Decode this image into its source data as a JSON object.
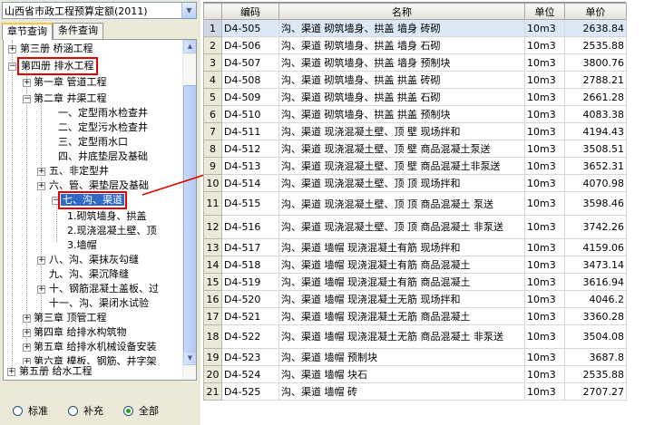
{
  "window": {
    "dropdown_value": "山西省市政工程预算定额(2011)"
  },
  "tabs": [
    {
      "label": "章节查询",
      "active": true
    },
    {
      "label": "条件查询",
      "active": false
    }
  ],
  "tree": {
    "n1": "第三册 桥涵工程",
    "n2": "第四册 排水工程",
    "n3": "第一章 管道工程",
    "n4": "第二章 井渠工程",
    "n5": "一、定型雨水检查井",
    "n6": "二、定型污水检查井",
    "n7": "三、定型雨水口",
    "n8": "四、井底垫层及基础",
    "n9": "五、非定型井",
    "n10": "六、管、渠垫层及基础",
    "n11": "七、沟、渠道",
    "n12": "1.砌筑墙身、拱盖",
    "n13": "2.现浇混凝土壁、顶",
    "n14": "3.墙帽",
    "n15": "八、沟、渠抹灰勾缝",
    "n16": "九、沟、渠沉降缝",
    "n17": "十、钢筋混凝土盖板、过",
    "n18": "十一、沟、渠闭水试验",
    "n19": "第三章 顶管工程",
    "n20": "第四章 给排水构筑物",
    "n21": "第五章 给排水机械设备安装",
    "n22": "第六章 模板、钢筋、井字架",
    "n23": "第五册 给水工程"
  },
  "filter": {
    "opt1": "标准",
    "opt2": "补充",
    "opt3": "全部",
    "selected": "全部"
  },
  "table": {
    "columns": [
      "编码",
      "名称",
      "单位",
      "单价"
    ],
    "rows": [
      {
        "n": "1",
        "code": "D4-505",
        "name": "沟、渠道 砌筑墙身、拱盖 墙身 砖砌",
        "unit": "10m3",
        "price": "2638.84"
      },
      {
        "n": "2",
        "code": "D4-506",
        "name": "沟、渠道 砌筑墙身、拱盖 墙身 石砌",
        "unit": "10m3",
        "price": "2535.88"
      },
      {
        "n": "3",
        "code": "D4-507",
        "name": "沟、渠道 砌筑墙身、拱盖 墙身 预制块",
        "unit": "10m3",
        "price": "3800.76"
      },
      {
        "n": "4",
        "code": "D4-508",
        "name": "沟、渠道 砌筑墙身、拱盖 拱盖 砖砌",
        "unit": "10m3",
        "price": "2788.21"
      },
      {
        "n": "5",
        "code": "D4-509",
        "name": "沟、渠道 砌筑墙身、拱盖 拱盖 石砌",
        "unit": "10m3",
        "price": "2661.28"
      },
      {
        "n": "6",
        "code": "D4-510",
        "name": "沟、渠道 砌筑墙身、拱盖 拱盖 预制块",
        "unit": "10m3",
        "price": "4083.38"
      },
      {
        "n": "7",
        "code": "D4-511",
        "name": "沟、渠道 现浇混凝土壁、顶 壁 现场拌和",
        "unit": "10m3",
        "price": "4194.43"
      },
      {
        "n": "8",
        "code": "D4-512",
        "name": "沟、渠道 现浇混凝土壁、顶 壁 商品混凝土泵送",
        "unit": "10m3",
        "price": "3508.51"
      },
      {
        "n": "9",
        "code": "D4-513",
        "name": "沟、渠道 现浇混凝土壁、顶 壁 商品混凝土非泵送",
        "unit": "10m3",
        "price": "3652.31"
      },
      {
        "n": "10",
        "code": "D4-514",
        "name": "沟、渠道 现浇混凝土壁、顶 顶 现场拌和",
        "unit": "10m3",
        "price": "4070.98"
      },
      {
        "n": "11",
        "code": "D4-515",
        "name": "沟、渠道 现浇混凝土壁、顶 顶 商品混凝土 泵送",
        "unit": "10m3",
        "price": "3598.46"
      },
      {
        "n": "12",
        "code": "D4-516",
        "name": "沟、渠道 现浇混凝土壁、顶 顶 商品混凝土 非泵送",
        "unit": "10m3",
        "price": "3742.26"
      },
      {
        "n": "13",
        "code": "D4-517",
        "name": "沟、渠道 墙帽 现浇混凝土有筋 现场拌和",
        "unit": "10m3",
        "price": "4159.06"
      },
      {
        "n": "14",
        "code": "D4-518",
        "name": "沟、渠道 墙帽 现浇混凝土有筋 商品混凝土",
        "unit": "10m3",
        "price": "3473.14"
      },
      {
        "n": "15",
        "code": "D4-519",
        "name": "沟、渠道 墙帽 现浇混凝土有筋 商品混凝土",
        "unit": "10m3",
        "price": "3616.94"
      },
      {
        "n": "16",
        "code": "D4-520",
        "name": "沟、渠道 墙帽 现浇混凝土无筋 现场拌和",
        "unit": "10m3",
        "price": "4046.2"
      },
      {
        "n": "17",
        "code": "D4-521",
        "name": "沟、渠道 墙帽 现浇混凝土无筋 商品混凝土",
        "unit": "10m3",
        "price": "3360.28"
      },
      {
        "n": "18",
        "code": "D4-522",
        "name": "沟、渠道 墙帽 现浇混凝土无筋 商品混凝土 非泵送",
        "unit": "10m3",
        "price": "3504.08"
      },
      {
        "n": "19",
        "code": "D4-523",
        "name": "沟、渠道 墙帽 预制块",
        "unit": "10m3",
        "price": "3687.8"
      },
      {
        "n": "20",
        "code": "D4-524",
        "name": "沟、渠道 墙帽 块石",
        "unit": "10m3",
        "price": "2535.88"
      },
      {
        "n": "21",
        "code": "D4-525",
        "name": "沟、渠道 墙帽 砖",
        "unit": "10m3",
        "price": "2707.27"
      }
    ]
  },
  "colors": {
    "selection": "#316ac5",
    "annotation": "#e00000",
    "row_highlight": "#dce8f7"
  }
}
